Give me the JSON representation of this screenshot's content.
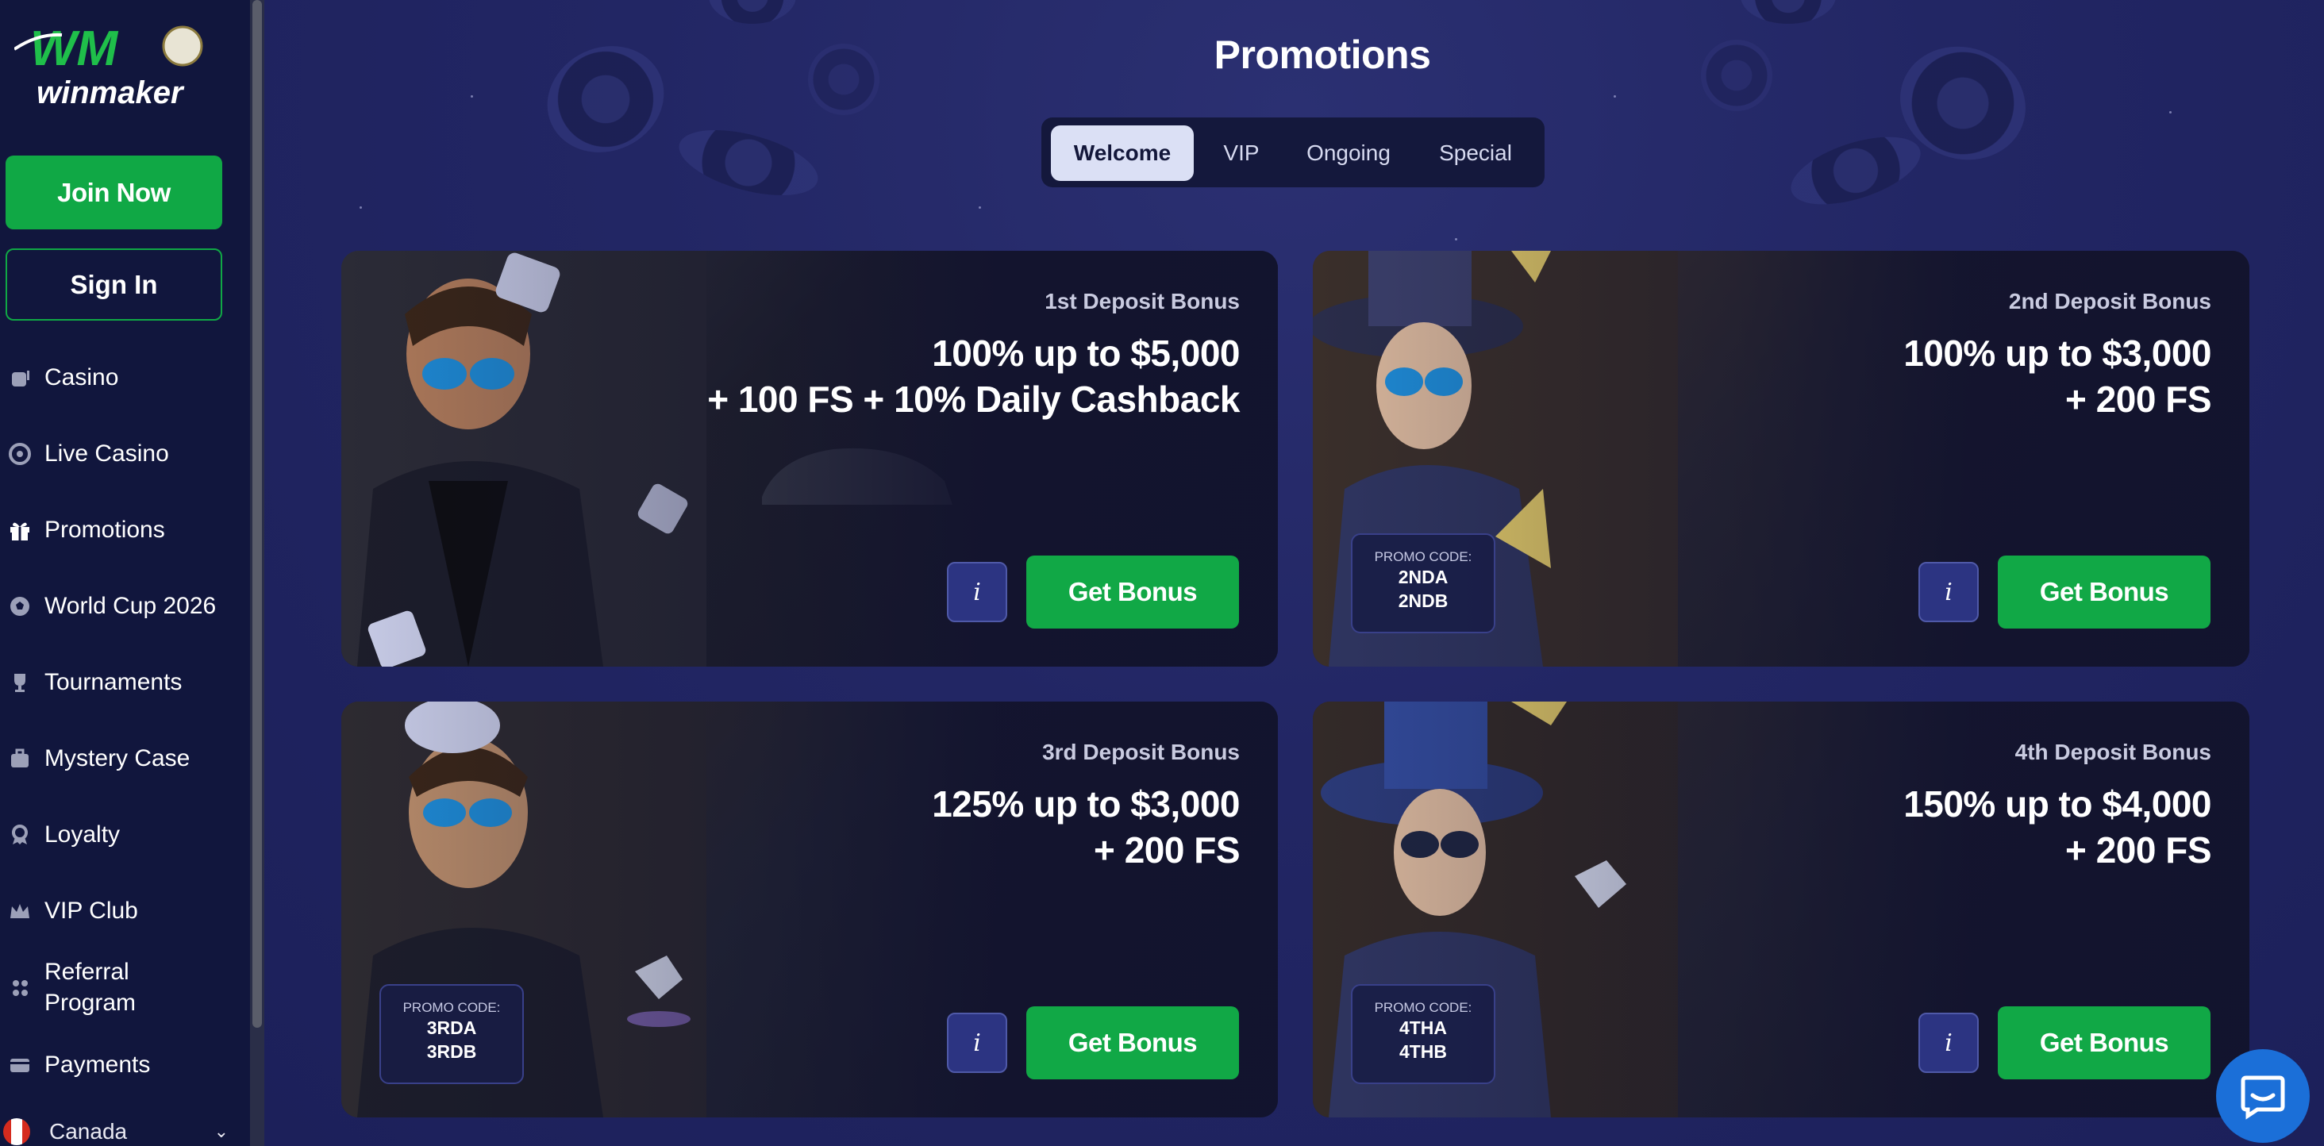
{
  "brand": {
    "logo_text": "winmaker",
    "logo_letters": "WM"
  },
  "sidebar": {
    "join_label": "Join Now",
    "signin_label": "Sign In",
    "items": [
      {
        "label": "Casino",
        "icon": "slot-machine-icon"
      },
      {
        "label": "Live Casino",
        "icon": "roulette-icon"
      },
      {
        "label": "Promotions",
        "icon": "gift-icon"
      },
      {
        "label": "World Cup 2026",
        "icon": "soccer-ball-icon"
      },
      {
        "label": "Tournaments",
        "icon": "trophy-icon"
      },
      {
        "label": "Mystery Case",
        "icon": "briefcase-icon"
      },
      {
        "label": "Loyalty",
        "icon": "medal-icon"
      },
      {
        "label": "VIP Club",
        "icon": "crown-icon"
      },
      {
        "label": "Referral",
        "label2": "Program",
        "icon": "users-icon"
      },
      {
        "label": "Payments",
        "icon": "card-icon"
      }
    ],
    "country": "Canada"
  },
  "page": {
    "title": "Promotions"
  },
  "tabs": [
    {
      "label": "Welcome",
      "active": true
    },
    {
      "label": "VIP",
      "active": false
    },
    {
      "label": "Ongoing",
      "active": false
    },
    {
      "label": "Special",
      "active": false
    }
  ],
  "cards": [
    {
      "subtitle": "1st Deposit Bonus",
      "line1": "100% up to $5,000",
      "line2": "+ 100 FS + 10% Daily Cashback",
      "info": "i",
      "cta": "Get Bonus"
    },
    {
      "subtitle": "2nd Deposit Bonus",
      "line1": "100% up to $3,000",
      "line2": "+ 200 FS",
      "info": "i",
      "cta": "Get Bonus",
      "promo_label": "PROMO CODE:",
      "promo_code1": "2NDA",
      "promo_code2": "2NDB"
    },
    {
      "subtitle": "3rd Deposit Bonus",
      "line1": "125% up to $3,000",
      "line2": "+ 200 FS",
      "info": "i",
      "cta": "Get Bonus",
      "promo_label": "PROMO CODE:",
      "promo_code1": "3RDA",
      "promo_code2": "3RDB"
    },
    {
      "subtitle": "4th Deposit Bonus",
      "line1": "150% up to $4,000",
      "line2": "+ 200 FS",
      "info": "i",
      "cta": "Get Bonus",
      "promo_label": "PROMO CODE:",
      "promo_code1": "4THA",
      "promo_code2": "4THB"
    }
  ],
  "colors": {
    "accent_green": "#10a845",
    "sidebar_bg": "#11163d",
    "main_bg": "#222664",
    "chat_blue": "#1b6fd8"
  }
}
